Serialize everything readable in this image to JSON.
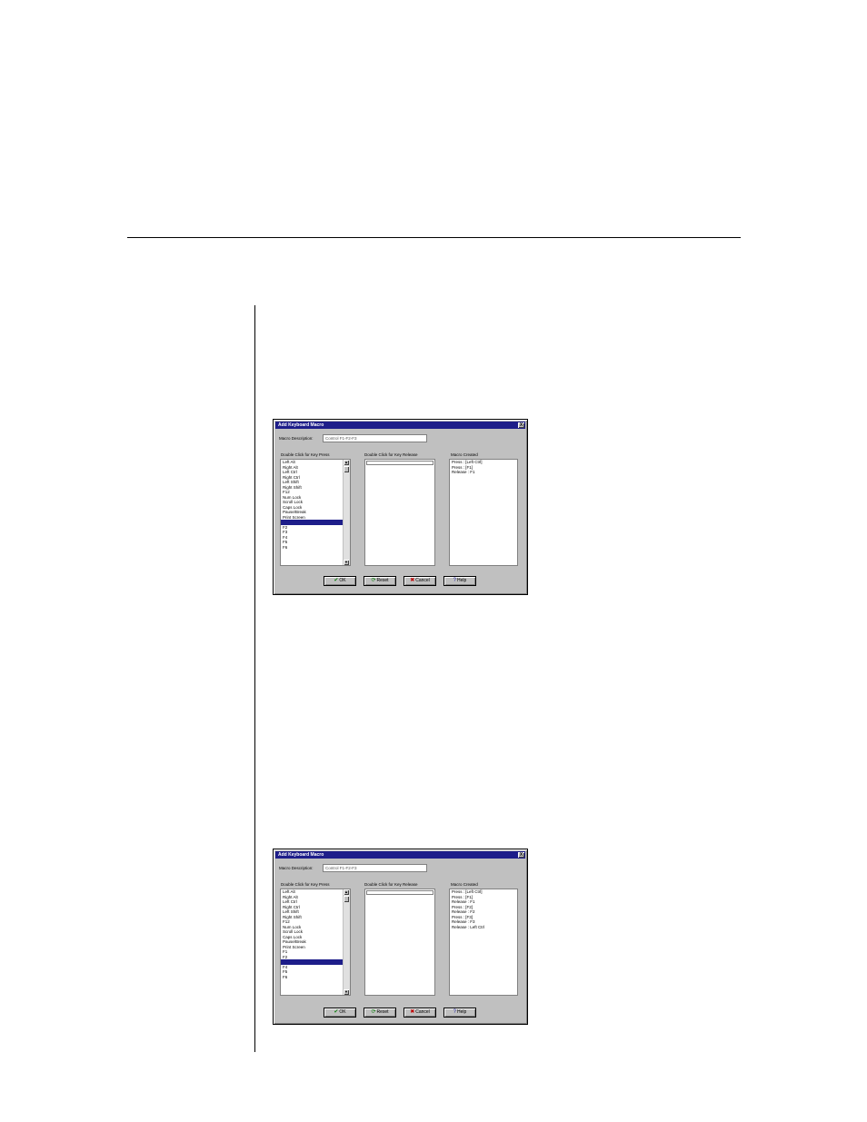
{
  "dialogs": [
    {
      "title": "Add Keyboard Macro",
      "close_label": "X",
      "macro_description_label": "Macro Description:",
      "macro_description_value": "Control F1-F2-F3",
      "key_press_label": "Double Click for Key Press",
      "key_release_label": "Double Click for Key Release",
      "macro_created_label": "Macro Created",
      "key_press_items": [
        "Left Alt",
        "Right Alt",
        "Left Ctrl",
        "Right Ctrl",
        "Left Shift",
        "Right Shift",
        "F12",
        "Num Lock",
        "Scroll Lock",
        "Caps Lock",
        "Pause/Break",
        "Print Screen",
        "F1",
        "F2",
        "F3",
        "F4",
        "F5",
        "F6"
      ],
      "macro_created_items": [
        "Press : [Left Ctrl]",
        "Press : [F1]",
        "Release : F1"
      ],
      "buttons": {
        "ok": "OK",
        "reset": "Reset",
        "cancel": "Cancel",
        "help": "Help"
      }
    },
    {
      "title": "Add Keyboard Macro",
      "close_label": "X",
      "macro_description_label": "Macro Description:",
      "macro_description_value": "Control F1-F2-F3",
      "key_press_label": "Double Click for Key Press",
      "key_release_label": "Double Click for Key Release",
      "macro_created_label": "Macro Created",
      "key_press_items": [
        "Left Alt",
        "Right Alt",
        "Left Ctrl",
        "Right Ctrl",
        "Left Shift",
        "Right Shift",
        "F12",
        "Num Lock",
        "Scroll Lock",
        "Caps Lock",
        "Pause/Break",
        "Print Screen",
        "F1",
        "F2",
        "F3",
        "F4",
        "F5",
        "F6"
      ],
      "macro_created_items": [
        "Press : [Left Ctrl]",
        "Press : [F1]",
        "Release : F1",
        "Press : [F2]",
        "Release : F2",
        "Press : [F3]",
        "Release : F3",
        "Release : Left Ctrl"
      ],
      "buttons": {
        "ok": "OK",
        "reset": "Reset",
        "cancel": "Cancel",
        "help": "Help"
      }
    }
  ]
}
